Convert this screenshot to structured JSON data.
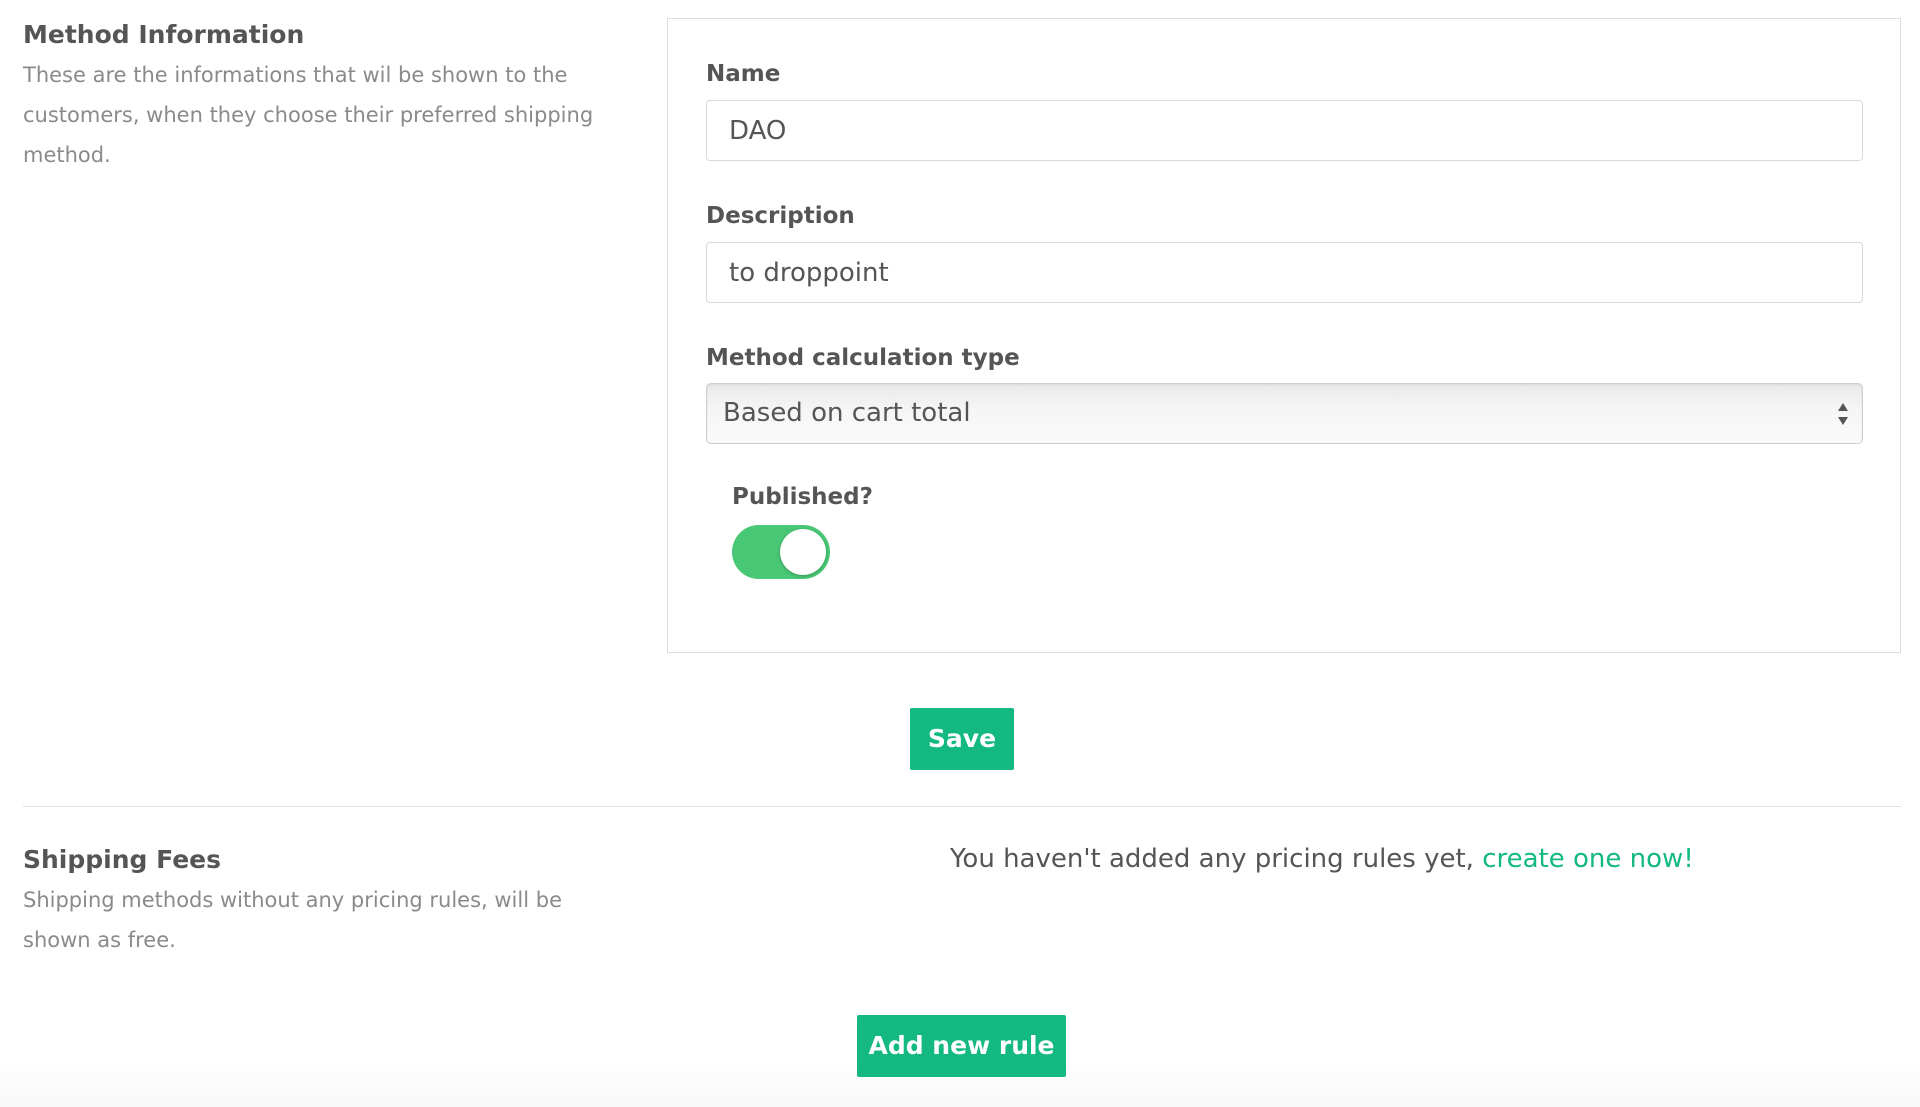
{
  "method_info": {
    "title": "Method Information",
    "description": "These are the informations that wil be shown to the customers, when they choose their preferred shipping method."
  },
  "form": {
    "name_label": "Name",
    "name_value": "DAO",
    "description_label": "Description",
    "description_value": "to droppoint",
    "calc_type_label": "Method calculation type",
    "calc_type_selected": "Based on cart total",
    "published_label": "Published?",
    "published": true
  },
  "actions": {
    "save_label": "Save",
    "add_rule_label": "Add new rule"
  },
  "shipping_fees": {
    "title": "Shipping Fees",
    "description": "Shipping methods without any pricing rules, will be shown as free.",
    "empty_message": "You haven't added any pricing rules yet, ",
    "empty_link": "create one now!"
  },
  "colors": {
    "accent": "#13b981",
    "toggle_on": "#48c774",
    "text": "#555555",
    "muted_text": "#8a8a8a",
    "border": "#dcdcdc"
  },
  "icons": {
    "select_arrows": "sort-arrows-icon"
  }
}
